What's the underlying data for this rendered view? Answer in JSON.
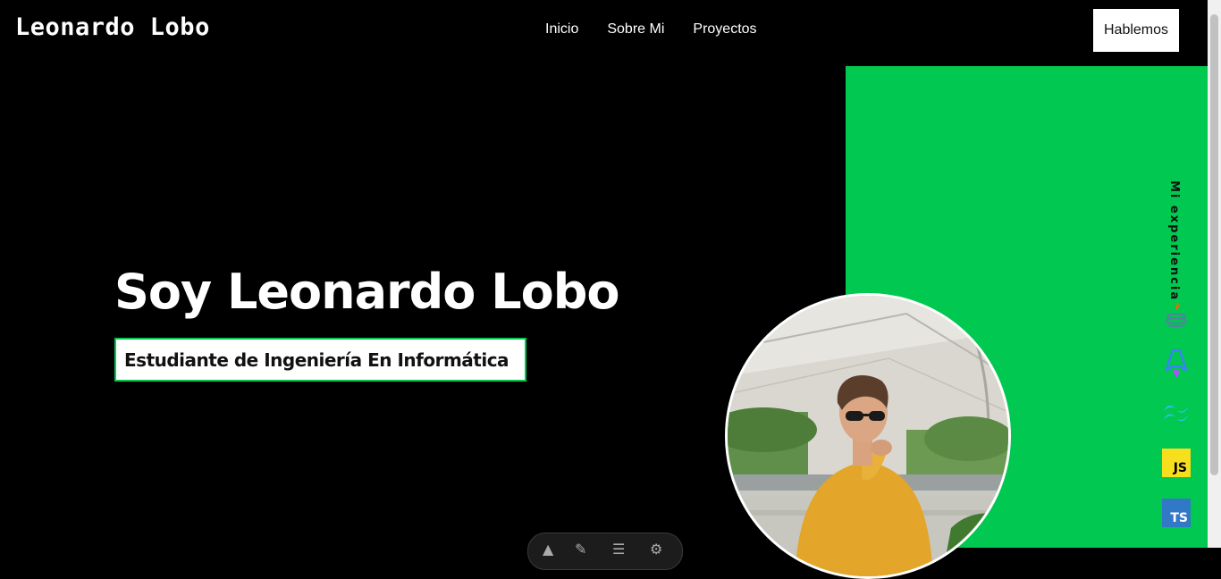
{
  "header": {
    "brand": "Leonardo Lobo",
    "nav": [
      {
        "label": "Inicio"
      },
      {
        "label": "Sobre Mi"
      },
      {
        "label": "Proyectos"
      }
    ],
    "cta_label": "Hablemos"
  },
  "hero": {
    "title": "Soy Leonardo Lobo",
    "subtitle": "Estudiante de Ingeniería En Informática"
  },
  "experience": {
    "label": "Mi experiencia",
    "techs": [
      {
        "icon": "java-icon",
        "color": "#e76f00"
      },
      {
        "icon": "astro-icon",
        "color": "#7c3aed"
      },
      {
        "icon": "tailwind-icon",
        "color": "#38bdf8"
      },
      {
        "icon": "javascript-icon",
        "text": "JS",
        "color": "#f7df1e"
      },
      {
        "icon": "typescript-icon",
        "text": "TS",
        "color": "#3178c6"
      }
    ]
  },
  "colors": {
    "accent": "#00c850",
    "background": "#000000"
  }
}
